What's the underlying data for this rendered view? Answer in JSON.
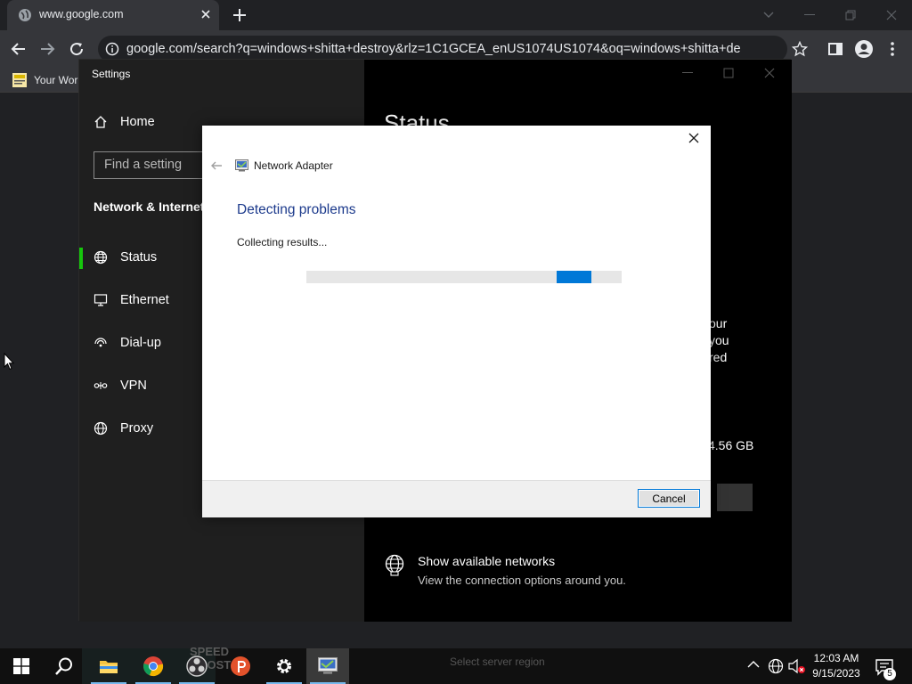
{
  "browser": {
    "tab_title": "www.google.com",
    "url": "google.com/search?q=windows+shitta+destroy&rlz=1C1GCEA_enUS1074US1074&oq=windows+shitta+destro...",
    "bookmark_label": "Your Wor"
  },
  "settings": {
    "window_title": "Settings",
    "home": "Home",
    "search_placeholder": "Find a setting",
    "section_title": "Network & Internet",
    "nav": [
      {
        "label": "Status",
        "icon": "globe-status-icon"
      },
      {
        "label": "Ethernet",
        "icon": "ethernet-icon"
      },
      {
        "label": "Dial-up",
        "icon": "dialup-icon"
      },
      {
        "label": "VPN",
        "icon": "vpn-icon"
      },
      {
        "label": "Proxy",
        "icon": "globe-icon"
      }
    ],
    "page_title": "Status",
    "partial_lines": [
      "our",
      "you",
      "red"
    ],
    "data_usage": "4.56 GB",
    "show_networks_title": "Show available networks",
    "show_networks_desc": "View the connection options around you."
  },
  "dialog": {
    "app_name": "Network Adapter",
    "heading": "Detecting problems",
    "status": "Collecting results...",
    "progress_position": 0.85,
    "cancel_label": "Cancel"
  },
  "taskbar": {
    "speed_boost_text": "SPEED BOOST",
    "ghost_text": "Select server region",
    "time": "12:03 AM",
    "date": "9/15/2023",
    "notification_count": "5"
  },
  "colors": {
    "accent": "#0078d7",
    "heading_blue": "#1c3a8c",
    "status_green": "#16c60c"
  }
}
